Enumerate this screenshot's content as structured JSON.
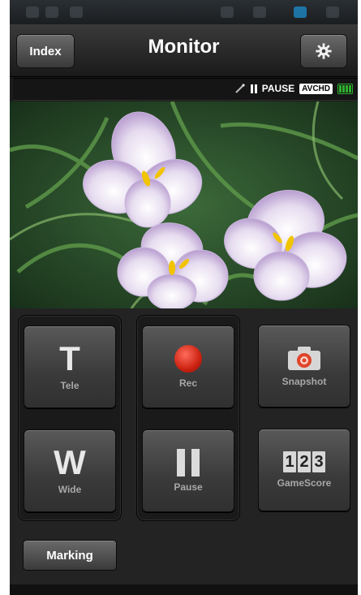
{
  "header": {
    "index_label": "Index",
    "title": "Monitor",
    "settings_icon": "gear-icon"
  },
  "status": {
    "pause_text": "PAUSE",
    "format_badge": "AVCHD",
    "icons": [
      "remote-icon",
      "pause-icon",
      "battery-icon"
    ]
  },
  "controls": {
    "tele": {
      "glyph": "T",
      "label": "Tele"
    },
    "wide": {
      "glyph": "W",
      "label": "Wide"
    },
    "rec": {
      "label": "Rec"
    },
    "pause": {
      "label": "Pause"
    },
    "snapshot": {
      "label": "Snapshot"
    },
    "gamescore": {
      "digits": [
        "1",
        "2",
        "3"
      ],
      "label": "GameScore"
    },
    "marking_label": "Marking"
  },
  "colors": {
    "rec_red": "#cc2211",
    "battery_green": "#2fb02f",
    "snapshot_accent": "#e0442a"
  }
}
